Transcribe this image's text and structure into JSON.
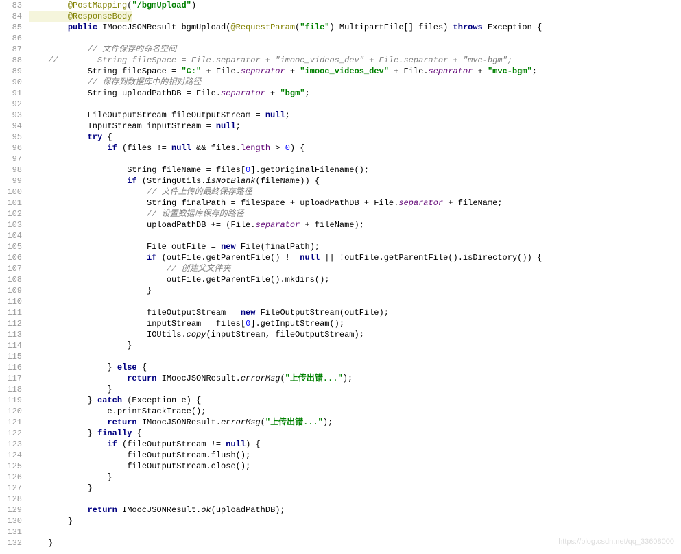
{
  "watermark": "https://blog.csdn.net/qq_33608000",
  "lines": [
    {
      "ln": "83",
      "hl": false,
      "ind": "    ",
      "tokens": [
        [
          "ann",
          "@PostMapping"
        ],
        [
          "p",
          "("
        ],
        [
          "str",
          "\"/bgmUpload\""
        ],
        [
          "p",
          ")"
        ]
      ]
    },
    {
      "ln": "84",
      "hl": true,
      "ind": "    ",
      "tokens": [
        [
          "ann",
          "@ResponseBody"
        ]
      ]
    },
    {
      "ln": "85",
      "hl": false,
      "ind": "    ",
      "tokens": [
        [
          "kw",
          "public"
        ],
        [
          "p",
          " IMoocJSONResult bgmUpload("
        ],
        [
          "ann",
          "@RequestParam"
        ],
        [
          "p",
          "("
        ],
        [
          "str",
          "\"file\""
        ],
        [
          "p",
          ") MultipartFile[] files) "
        ],
        [
          "kw",
          "throws"
        ],
        [
          "p",
          " Exception {"
        ]
      ]
    },
    {
      "ln": "86",
      "hl": false,
      "ind": "",
      "tokens": []
    },
    {
      "ln": "87",
      "hl": false,
      "ind": "        ",
      "tokens": [
        [
          "cmt",
          "// 文件保存的命名空间"
        ]
      ]
    },
    {
      "ln": "88",
      "hl": false,
      "ind": "",
      "tokens": [
        [
          "cmt",
          "//        String fileSpace = File.separator + \"imooc_videos_dev\" + File.separator + \"mvc-bgm\";"
        ]
      ]
    },
    {
      "ln": "89",
      "hl": false,
      "ind": "        ",
      "tokens": [
        [
          "p",
          "String fileSpace = "
        ],
        [
          "str",
          "\"C:\""
        ],
        [
          "p",
          " + File."
        ],
        [
          "fld-i",
          "separator"
        ],
        [
          "p",
          " + "
        ],
        [
          "str",
          "\"imooc_videos_dev\""
        ],
        [
          "p",
          " + File."
        ],
        [
          "fld-i",
          "separator"
        ],
        [
          "p",
          " + "
        ],
        [
          "str",
          "\"mvc-bgm\""
        ],
        [
          "p",
          ";"
        ]
      ]
    },
    {
      "ln": "90",
      "hl": false,
      "ind": "        ",
      "tokens": [
        [
          "cmt",
          "// 保存到数据库中的相对路径"
        ]
      ]
    },
    {
      "ln": "91",
      "hl": false,
      "ind": "        ",
      "tokens": [
        [
          "p",
          "String uploadPathDB = File."
        ],
        [
          "fld-i",
          "separator"
        ],
        [
          "p",
          " + "
        ],
        [
          "str",
          "\"bgm\""
        ],
        [
          "p",
          ";"
        ]
      ]
    },
    {
      "ln": "92",
      "hl": false,
      "ind": "",
      "tokens": []
    },
    {
      "ln": "93",
      "hl": false,
      "ind": "        ",
      "tokens": [
        [
          "p",
          "FileOutputStream fileOutputStream = "
        ],
        [
          "kw",
          "null"
        ],
        [
          "p",
          ";"
        ]
      ]
    },
    {
      "ln": "94",
      "hl": false,
      "ind": "        ",
      "tokens": [
        [
          "p",
          "InputStream inputStream = "
        ],
        [
          "kw",
          "null"
        ],
        [
          "p",
          ";"
        ]
      ]
    },
    {
      "ln": "95",
      "hl": false,
      "ind": "        ",
      "tokens": [
        [
          "kw",
          "try"
        ],
        [
          "p",
          " {"
        ]
      ]
    },
    {
      "ln": "96",
      "hl": false,
      "ind": "            ",
      "tokens": [
        [
          "kw",
          "if"
        ],
        [
          "p",
          " (files != "
        ],
        [
          "kw",
          "null"
        ],
        [
          "p",
          " && files."
        ],
        [
          "fld",
          "length"
        ],
        [
          "p",
          " > "
        ],
        [
          "num",
          "0"
        ],
        [
          "p",
          ") {"
        ]
      ]
    },
    {
      "ln": "97",
      "hl": false,
      "ind": "",
      "tokens": []
    },
    {
      "ln": "98",
      "hl": false,
      "ind": "                ",
      "tokens": [
        [
          "p",
          "String fileName = files["
        ],
        [
          "num",
          "0"
        ],
        [
          "p",
          "].getOriginalFilename();"
        ]
      ]
    },
    {
      "ln": "99",
      "hl": false,
      "ind": "                ",
      "tokens": [
        [
          "kw",
          "if"
        ],
        [
          "p",
          " (StringUtils."
        ],
        [
          "stat",
          "isNotBlank"
        ],
        [
          "p",
          "(fileName)) {"
        ]
      ]
    },
    {
      "ln": "100",
      "hl": false,
      "ind": "                    ",
      "tokens": [
        [
          "cmt",
          "// 文件上传的最终保存路径"
        ]
      ]
    },
    {
      "ln": "101",
      "hl": false,
      "ind": "                    ",
      "tokens": [
        [
          "p",
          "String finalPath = fileSpace + uploadPathDB + File."
        ],
        [
          "fld-i",
          "separator"
        ],
        [
          "p",
          " + fileName;"
        ]
      ]
    },
    {
      "ln": "102",
      "hl": false,
      "ind": "                    ",
      "tokens": [
        [
          "cmt",
          "// 设置数据库保存的路径"
        ]
      ]
    },
    {
      "ln": "103",
      "hl": false,
      "ind": "                    ",
      "tokens": [
        [
          "p",
          "uploadPathDB += (File."
        ],
        [
          "fld-i",
          "separator"
        ],
        [
          "p",
          " + fileName);"
        ]
      ]
    },
    {
      "ln": "104",
      "hl": false,
      "ind": "",
      "tokens": []
    },
    {
      "ln": "105",
      "hl": false,
      "ind": "                    ",
      "tokens": [
        [
          "p",
          "File outFile = "
        ],
        [
          "kw",
          "new"
        ],
        [
          "p",
          " File(finalPath);"
        ]
      ]
    },
    {
      "ln": "106",
      "hl": false,
      "ind": "                    ",
      "tokens": [
        [
          "kw",
          "if"
        ],
        [
          "p",
          " (outFile.getParentFile() != "
        ],
        [
          "kw",
          "null"
        ],
        [
          "p",
          " || !outFile.getParentFile().isDirectory()) {"
        ]
      ]
    },
    {
      "ln": "107",
      "hl": false,
      "ind": "                        ",
      "tokens": [
        [
          "cmt",
          "// 创建父文件夹"
        ]
      ]
    },
    {
      "ln": "108",
      "hl": false,
      "ind": "                        ",
      "tokens": [
        [
          "p",
          "outFile.getParentFile().mkdirs();"
        ]
      ]
    },
    {
      "ln": "109",
      "hl": false,
      "ind": "                    ",
      "tokens": [
        [
          "p",
          "}"
        ]
      ]
    },
    {
      "ln": "110",
      "hl": false,
      "ind": "",
      "tokens": []
    },
    {
      "ln": "111",
      "hl": false,
      "ind": "                    ",
      "tokens": [
        [
          "p",
          "fileOutputStream = "
        ],
        [
          "kw",
          "new"
        ],
        [
          "p",
          " FileOutputStream(outFile);"
        ]
      ]
    },
    {
      "ln": "112",
      "hl": false,
      "ind": "                    ",
      "tokens": [
        [
          "p",
          "inputStream = files["
        ],
        [
          "num",
          "0"
        ],
        [
          "p",
          "].getInputStream();"
        ]
      ]
    },
    {
      "ln": "113",
      "hl": false,
      "ind": "                    ",
      "tokens": [
        [
          "p",
          "IOUtils."
        ],
        [
          "stat",
          "copy"
        ],
        [
          "p",
          "(inputStream, fileOutputStream);"
        ]
      ]
    },
    {
      "ln": "114",
      "hl": false,
      "ind": "                ",
      "tokens": [
        [
          "p",
          "}"
        ]
      ]
    },
    {
      "ln": "115",
      "hl": false,
      "ind": "",
      "tokens": []
    },
    {
      "ln": "116",
      "hl": false,
      "ind": "            ",
      "tokens": [
        [
          "p",
          "} "
        ],
        [
          "kw",
          "else"
        ],
        [
          "p",
          " {"
        ]
      ]
    },
    {
      "ln": "117",
      "hl": false,
      "ind": "                ",
      "tokens": [
        [
          "kw",
          "return"
        ],
        [
          "p",
          " IMoocJSONResult."
        ],
        [
          "stat",
          "errorMsg"
        ],
        [
          "p",
          "("
        ],
        [
          "str",
          "\"上传出错...\""
        ],
        [
          "p",
          ");"
        ]
      ]
    },
    {
      "ln": "118",
      "hl": false,
      "ind": "            ",
      "tokens": [
        [
          "p",
          "}"
        ]
      ]
    },
    {
      "ln": "119",
      "hl": false,
      "ind": "        ",
      "tokens": [
        [
          "p",
          "} "
        ],
        [
          "kw",
          "catch"
        ],
        [
          "p",
          " (Exception e) {"
        ]
      ]
    },
    {
      "ln": "120",
      "hl": false,
      "ind": "            ",
      "tokens": [
        [
          "p",
          "e.printStackTrace();"
        ]
      ]
    },
    {
      "ln": "121",
      "hl": false,
      "ind": "            ",
      "tokens": [
        [
          "kw",
          "return"
        ],
        [
          "p",
          " IMoocJSONResult."
        ],
        [
          "stat",
          "errorMsg"
        ],
        [
          "p",
          "("
        ],
        [
          "str",
          "\"上传出错...\""
        ],
        [
          "p",
          ");"
        ]
      ]
    },
    {
      "ln": "122",
      "hl": false,
      "ind": "        ",
      "tokens": [
        [
          "p",
          "} "
        ],
        [
          "kw",
          "finally"
        ],
        [
          "p",
          " {"
        ]
      ]
    },
    {
      "ln": "123",
      "hl": false,
      "ind": "            ",
      "tokens": [
        [
          "kw",
          "if"
        ],
        [
          "p",
          " (fileOutputStream != "
        ],
        [
          "kw",
          "null"
        ],
        [
          "p",
          ") {"
        ]
      ]
    },
    {
      "ln": "124",
      "hl": false,
      "ind": "                ",
      "tokens": [
        [
          "p",
          "fileOutputStream.flush();"
        ]
      ]
    },
    {
      "ln": "125",
      "hl": false,
      "ind": "                ",
      "tokens": [
        [
          "p",
          "fileOutputStream.close();"
        ]
      ]
    },
    {
      "ln": "126",
      "hl": false,
      "ind": "            ",
      "tokens": [
        [
          "p",
          "}"
        ]
      ]
    },
    {
      "ln": "127",
      "hl": false,
      "ind": "        ",
      "tokens": [
        [
          "p",
          "}"
        ]
      ]
    },
    {
      "ln": "128",
      "hl": false,
      "ind": "",
      "tokens": []
    },
    {
      "ln": "129",
      "hl": false,
      "ind": "        ",
      "tokens": [
        [
          "kw",
          "return"
        ],
        [
          "p",
          " IMoocJSONResult."
        ],
        [
          "stat",
          "ok"
        ],
        [
          "p",
          "(uploadPathDB);"
        ]
      ]
    },
    {
      "ln": "130",
      "hl": false,
      "ind": "    ",
      "tokens": [
        [
          "p",
          "}"
        ]
      ]
    },
    {
      "ln": "131",
      "hl": false,
      "ind": "",
      "tokens": []
    },
    {
      "ln": "132",
      "hl": false,
      "ind": "",
      "tokens": [
        [
          "p",
          "}"
        ]
      ]
    }
  ]
}
